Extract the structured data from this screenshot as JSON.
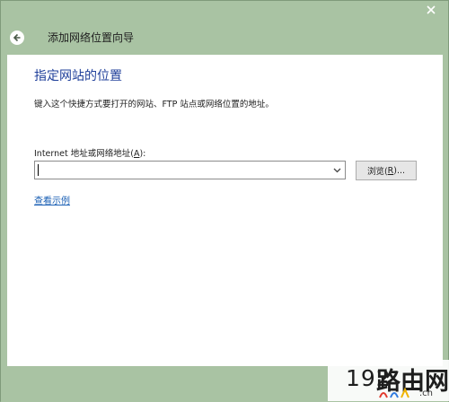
{
  "window": {
    "title": "添加网络位置向导",
    "close_icon": "close-icon",
    "back_icon": "back-arrow-icon"
  },
  "page": {
    "heading": "指定网站的位置",
    "description": "键入这个快捷方式要打开的网站、FTP 站点或网络位置的地址。",
    "field_label_prefix": "Internet 地址或网络地址(",
    "field_label_key": "A",
    "field_label_suffix": "):",
    "address_value": "",
    "browse_prefix": "浏览(",
    "browse_key": "R",
    "browse_suffix": ")...",
    "example_link": "查看示例"
  },
  "watermark": {
    "number": "192",
    "text": "路由网",
    "domain": ".cn"
  },
  "colors": {
    "chrome": "#a9c3a3",
    "heading": "#1f3f9a",
    "link": "#1a5fb4"
  }
}
